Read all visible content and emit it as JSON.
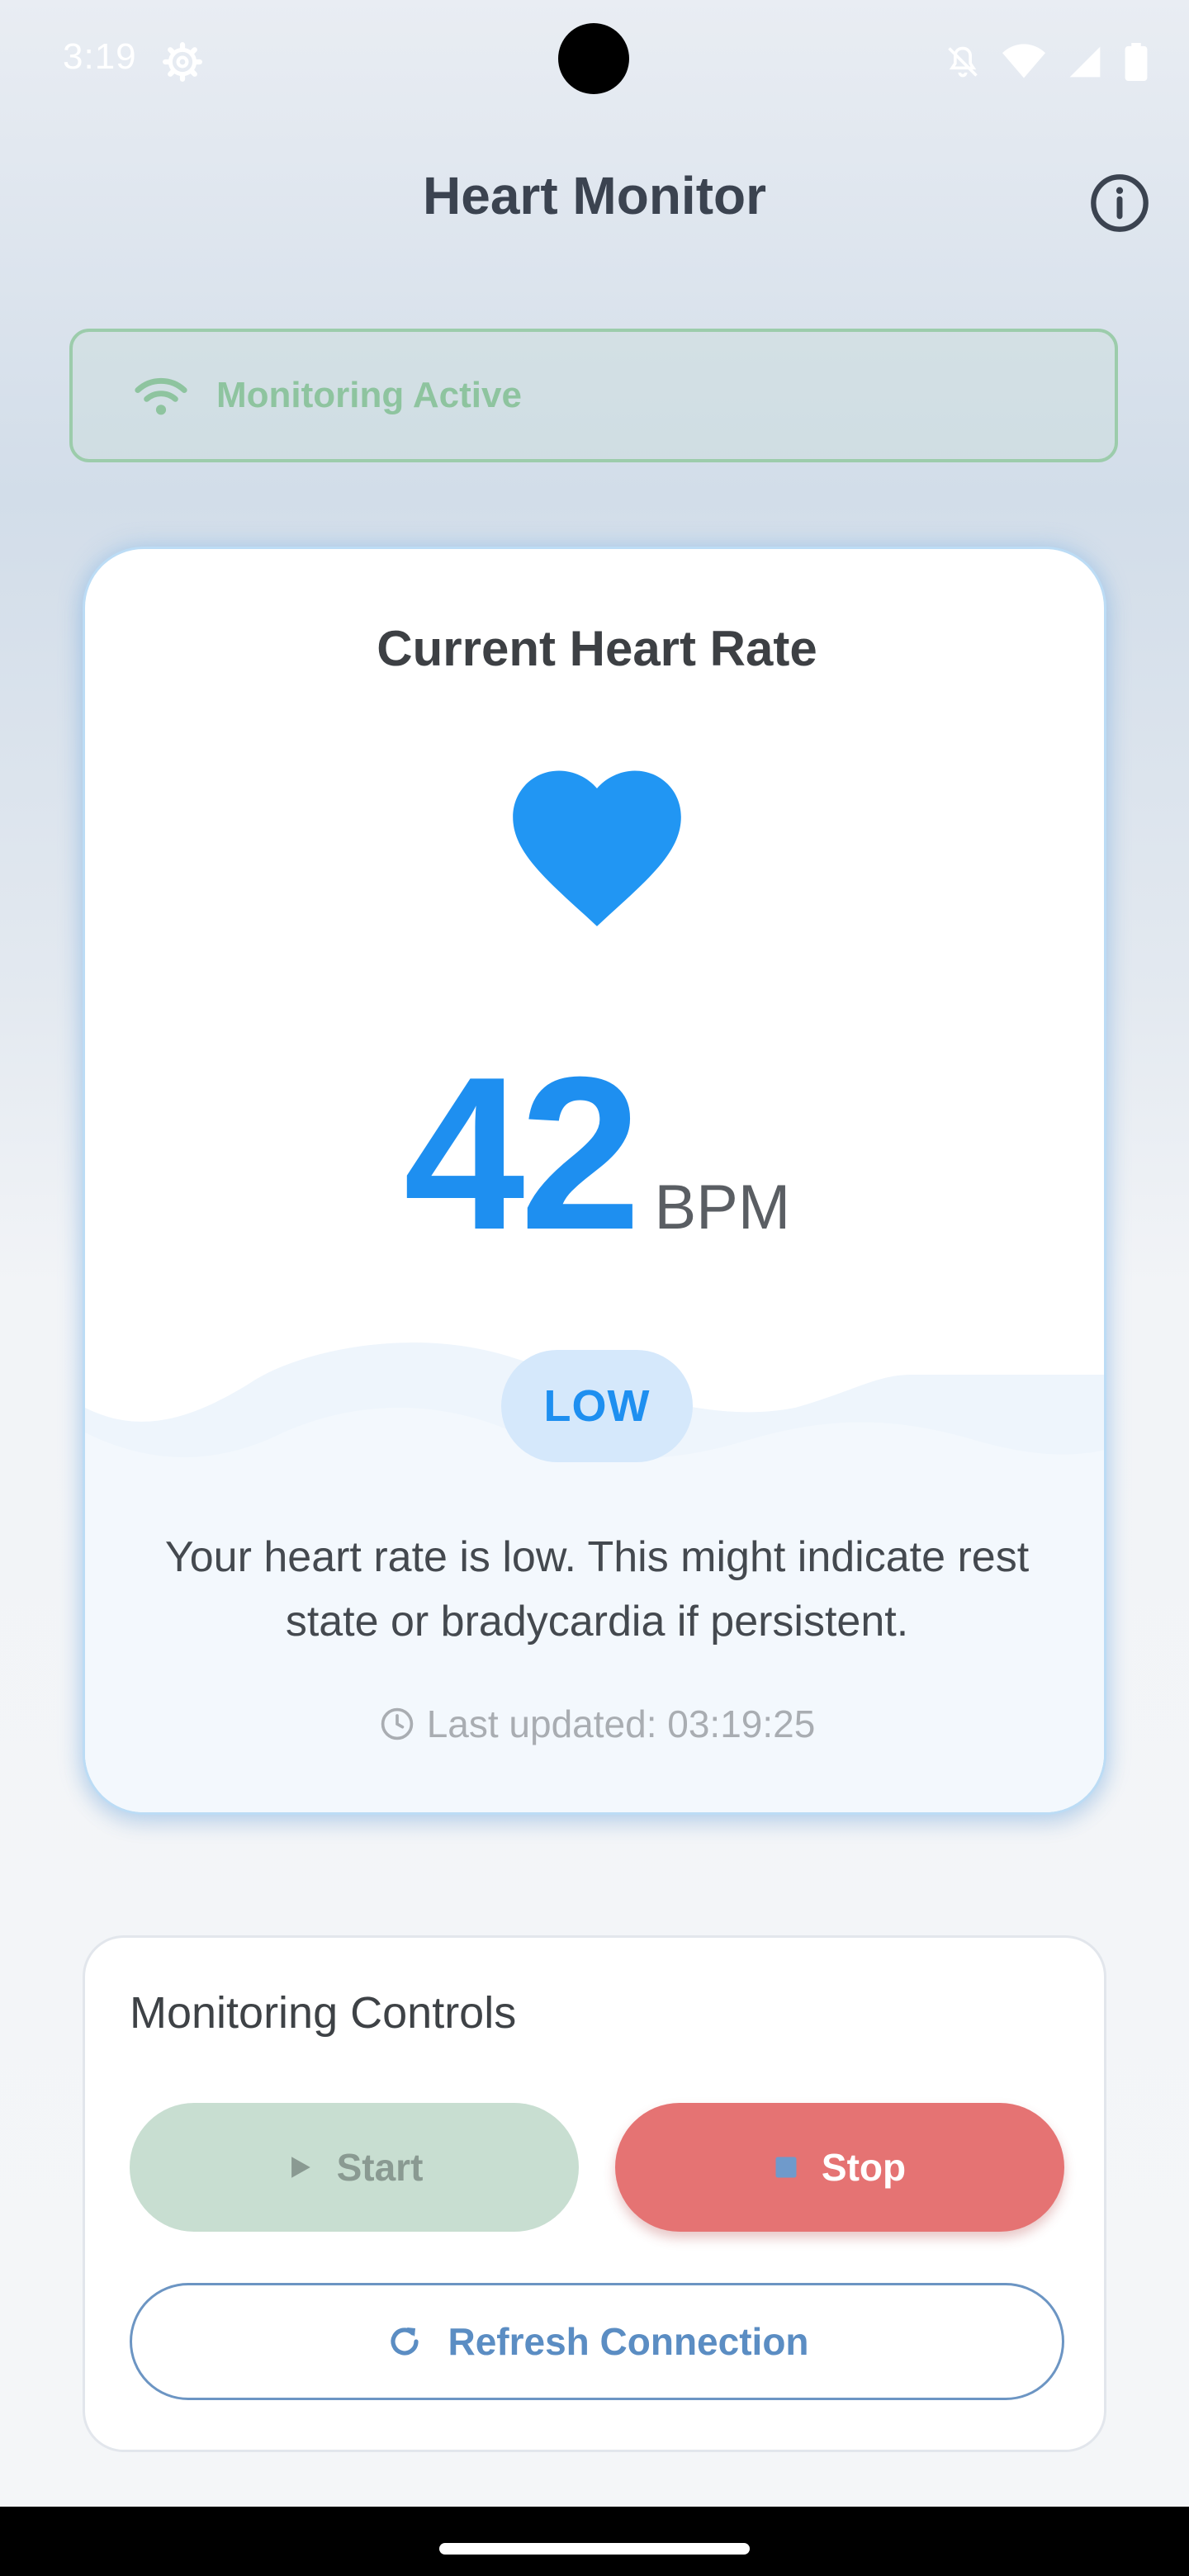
{
  "status_bar": {
    "time": "3:19",
    "icons": [
      "gear-icon",
      "bell-off-icon",
      "wifi-icon",
      "signal-icon",
      "battery-icon"
    ]
  },
  "app_bar": {
    "title": "Heart Monitor",
    "info_icon": "info-icon"
  },
  "banner": {
    "status": "Monitoring Active",
    "icon": "wifi-icon",
    "color": "#8ec49f"
  },
  "heart_card": {
    "title": "Current Heart Rate",
    "icon": "heart-icon",
    "bpm_value": "42",
    "bpm_unit": "BPM",
    "status_badge": "LOW",
    "description": "Your heart rate is low. This might indicate rest state or bradycardia if persistent.",
    "last_updated": "Last updated: 03:19:25",
    "accent": "#1e8ff0"
  },
  "controls": {
    "title": "Monitoring Controls",
    "start_label": "Start",
    "stop_label": "Stop",
    "refresh_label": "Refresh Connection",
    "stop_color": "#e57373",
    "start_color": "#c8ded1"
  }
}
